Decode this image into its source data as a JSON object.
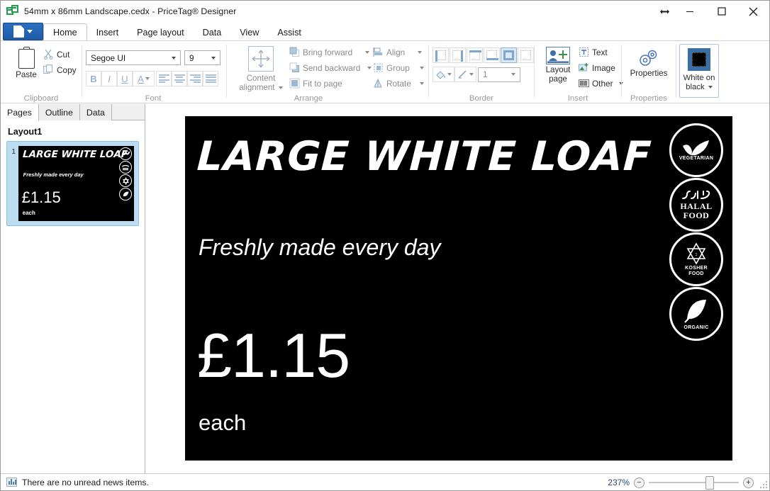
{
  "window": {
    "title": "54mm x 86mm Landscape.cedx - PriceTag® Designer",
    "app_icon": "pricetag-app-icon",
    "restore_label": "↔",
    "minimize_label": "—",
    "maximize_label": "□",
    "close_label": "✕",
    "help_label": "?"
  },
  "file_button": {
    "label": "File menu"
  },
  "tabs": [
    {
      "label": "Home",
      "active": true
    },
    {
      "label": "Insert",
      "active": false
    },
    {
      "label": "Page layout",
      "active": false
    },
    {
      "label": "Data",
      "active": false
    },
    {
      "label": "View",
      "active": false
    },
    {
      "label": "Assist",
      "active": false
    }
  ],
  "ribbon": {
    "clipboard": {
      "label": "Clipboard",
      "paste": "Paste",
      "cut": "Cut",
      "copy": "Copy"
    },
    "font": {
      "label": "Font",
      "font_family": "Segoe UI",
      "font_size": "9",
      "bold": "B",
      "italic": "I",
      "underline": "U",
      "font_color": "A",
      "align_left": "align-left",
      "align_center": "align-center",
      "align_right": "align-right",
      "align_justify": "align-justify"
    },
    "arrange": {
      "label": "Arrange",
      "content_alignment": "Content alignment",
      "bring_forward": "Bring forward",
      "send_backward": "Send backward",
      "fit_to_page": "Fit to page",
      "align": "Align",
      "group": "Group",
      "rotate": "Rotate"
    },
    "border": {
      "label": "Border",
      "width_value": "1",
      "styles": [
        "border-left",
        "border-right",
        "border-top",
        "border-bottom",
        "border-all",
        "border-none"
      ],
      "selected_style_index": 4
    },
    "insert": {
      "label": "Insert",
      "layout_page": "Layout\npage",
      "layout_page_line1": "Layout",
      "layout_page_line2": "page",
      "text": "Text",
      "image": "Image",
      "other": "Other"
    },
    "properties": {
      "label": "Properties",
      "properties_button": "Properties",
      "theme_line1": "White on",
      "theme_line2": "black"
    }
  },
  "left_panel": {
    "tabs": [
      {
        "label": "Pages",
        "active": true
      },
      {
        "label": "Outline",
        "active": false
      },
      {
        "label": "Data",
        "active": false
      }
    ],
    "layout_name": "Layout1",
    "pages": [
      {
        "number": "1",
        "selected": true
      }
    ]
  },
  "label": {
    "background": "#000000",
    "title": "LARGE WHITE LOAF",
    "subtitle": "Freshly made every day",
    "price": "£1.15",
    "unit": "each",
    "badges": [
      {
        "name": "vegetarian-badge",
        "line1": "VEGETARIAN",
        "line2": "",
        "icon": "leaf-check-icon"
      },
      {
        "name": "halal-badge",
        "line1": "HALAL",
        "line2": "FOOD",
        "icon": "arabic-halal-icon"
      },
      {
        "name": "kosher-badge",
        "line1": "KOSHER",
        "line2": "FOOD",
        "icon": "star-of-david-icon"
      },
      {
        "name": "organic-badge",
        "line1": "ORGANIC",
        "line2": "",
        "icon": "leaf-icon"
      }
    ]
  },
  "status_bar": {
    "news_text": "There are no unread news items.",
    "zoom_percent": "237%",
    "zoom_out": "−",
    "zoom_in": "+"
  }
}
